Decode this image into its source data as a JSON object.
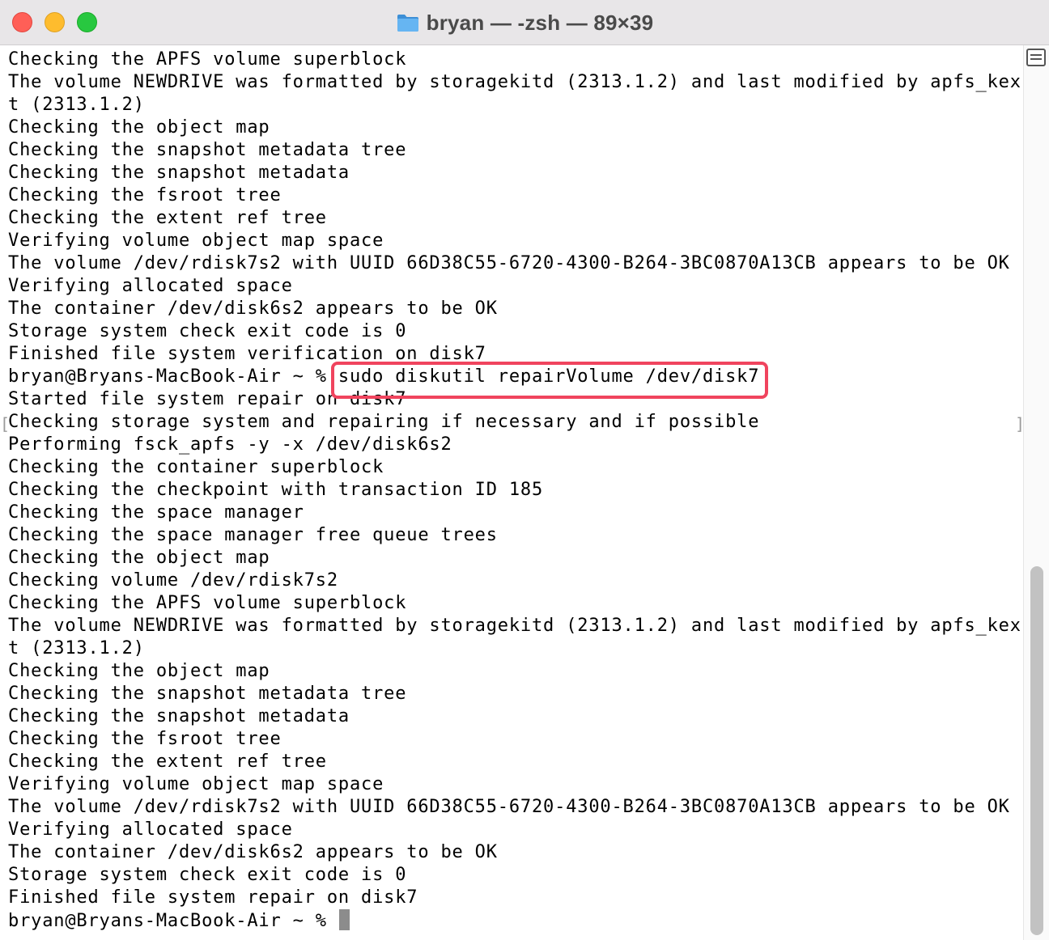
{
  "window": {
    "title": "bryan — -zsh — 89×39"
  },
  "icons": {
    "title": "folder-icon",
    "split": "split-pane-icon"
  },
  "colors": {
    "close": "#ff5f57",
    "minimize": "#febc2e",
    "zoom": "#28c840",
    "highlight": "#f0445e",
    "folder": "#56a9ee"
  },
  "terminal": {
    "lines": [
      "Checking the APFS volume superblock",
      "The volume NEWDRIVE was formatted by storagekitd (2313.1.2) and last modified by apfs_kex",
      "t (2313.1.2)",
      "Checking the object map",
      "Checking the snapshot metadata tree",
      "Checking the snapshot metadata",
      "Checking the fsroot tree",
      "Checking the extent ref tree",
      "Verifying volume object map space",
      "The volume /dev/rdisk7s2 with UUID 66D38C55-6720-4300-B264-3BC0870A13CB appears to be OK",
      "Verifying allocated space",
      "The container /dev/disk6s2 appears to be OK",
      "Storage system check exit code is 0",
      "Finished file system verification on disk7",
      "bryan@Bryans-MacBook-Air ~ % sudo diskutil repairVolume /dev/disk7",
      "Started file system repair on disk7",
      "Checking storage system and repairing if necessary and if possible",
      "Performing fsck_apfs -y -x /dev/disk6s2",
      "Checking the container superblock",
      "Checking the checkpoint with transaction ID 185",
      "Checking the space manager",
      "Checking the space manager free queue trees",
      "Checking the object map",
      "Checking volume /dev/rdisk7s2",
      "Checking the APFS volume superblock",
      "The volume NEWDRIVE was formatted by storagekitd (2313.1.2) and last modified by apfs_kex",
      "t (2313.1.2)",
      "Checking the object map",
      "Checking the snapshot metadata tree",
      "Checking the snapshot metadata",
      "Checking the fsroot tree",
      "Checking the extent ref tree",
      "Verifying volume object map space",
      "The volume /dev/rdisk7s2 with UUID 66D38C55-6720-4300-B264-3BC0870A13CB appears to be OK",
      "Verifying allocated space",
      "The container /dev/disk6s2 appears to be OK",
      "Storage system check exit code is 0",
      "Finished file system repair on disk7"
    ],
    "prompt": "bryan@Bryans-MacBook-Air ~ % ",
    "mark_left": "[",
    "mark_right": "]"
  }
}
